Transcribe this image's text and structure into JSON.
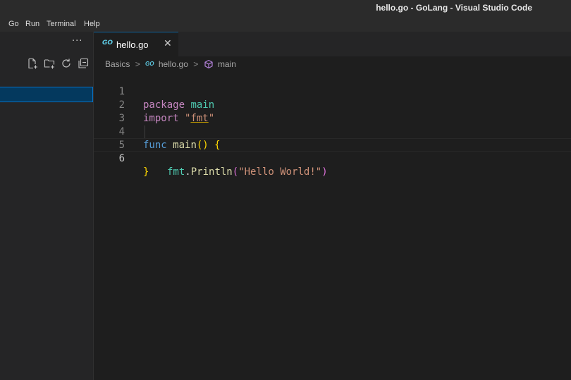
{
  "window": {
    "title": "hello.go - GoLang - Visual Studio Code"
  },
  "menu": {
    "items": [
      "Go",
      "Run",
      "Terminal",
      "Help"
    ]
  },
  "sidebar": {
    "more_label": "···",
    "tools": [
      "new-file-icon",
      "new-folder-icon",
      "refresh-icon",
      "collapse-all-icon"
    ]
  },
  "tab": {
    "icon_text": "GO",
    "label": "hello.go",
    "close": "✕"
  },
  "breadcrumb": {
    "folder": "Basics",
    "file_icon": "GO",
    "file": "hello.go",
    "symbol": "main",
    "separator": ">"
  },
  "editor": {
    "line_numbers": [
      "1",
      "2",
      "3",
      "4",
      "5",
      "6"
    ],
    "active_line": 6,
    "lines": [
      {
        "package_kw": "package",
        "package_name": "main"
      },
      {
        "import_kw": "import",
        "import_path": "fmt"
      },
      {},
      {
        "func_kw": "func",
        "func_name": "main",
        "parens": "()",
        "open_brace": "{"
      },
      {
        "pkg": "fmt",
        "dot": ".",
        "call": "Println",
        "open_paren": "(",
        "arg": "\"Hello World!\"",
        "close_paren": ")"
      },
      {
        "close_brace": "}"
      }
    ]
  }
}
